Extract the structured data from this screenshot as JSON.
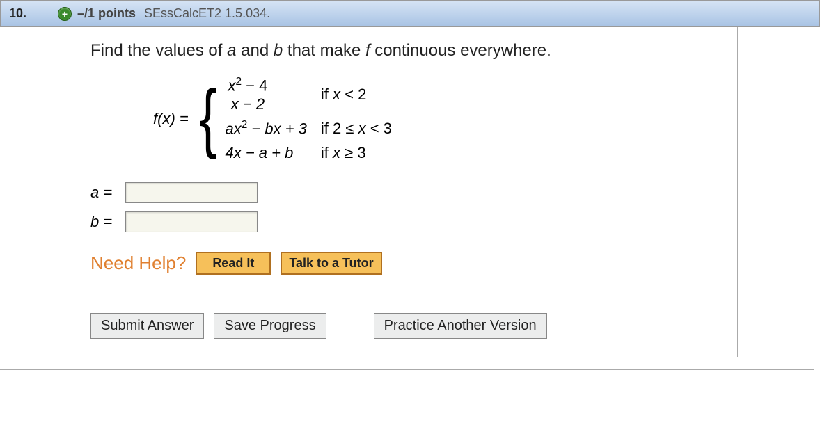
{
  "header": {
    "number": "10.",
    "points": "–/1 points",
    "qid": "SEssCalcET2 1.5.034."
  },
  "prompt": {
    "pre": "Find the values of ",
    "a": "a",
    "mid1": " and ",
    "b": "b",
    "mid2": " that make ",
    "f": "f",
    "post": " continuous everywhere."
  },
  "math": {
    "fx": "f(x) = ",
    "case1_num_pre": "x",
    "case1_num_sup": "2",
    "case1_num_post": " − 4",
    "case1_den": "x − 2",
    "cond1_pre": "if ",
    "cond1_x": "x",
    "cond1_post": " < 2",
    "case2_a": "ax",
    "case2_sup": "2",
    "case2_rest": " − bx + 3",
    "cond2_pre": "if 2 ≤ ",
    "cond2_x": "x",
    "cond2_post": " < 3",
    "case3": "4x − a + b",
    "cond3_pre": "if ",
    "cond3_x": "x",
    "cond3_post": " ≥ 3"
  },
  "answers": {
    "a_label": "a = ",
    "b_label": "b = "
  },
  "help": {
    "label": "Need Help?",
    "read": "Read It",
    "tutor": "Talk to a Tutor"
  },
  "actions": {
    "submit": "Submit Answer",
    "save": "Save Progress",
    "practice": "Practice Another Version"
  }
}
